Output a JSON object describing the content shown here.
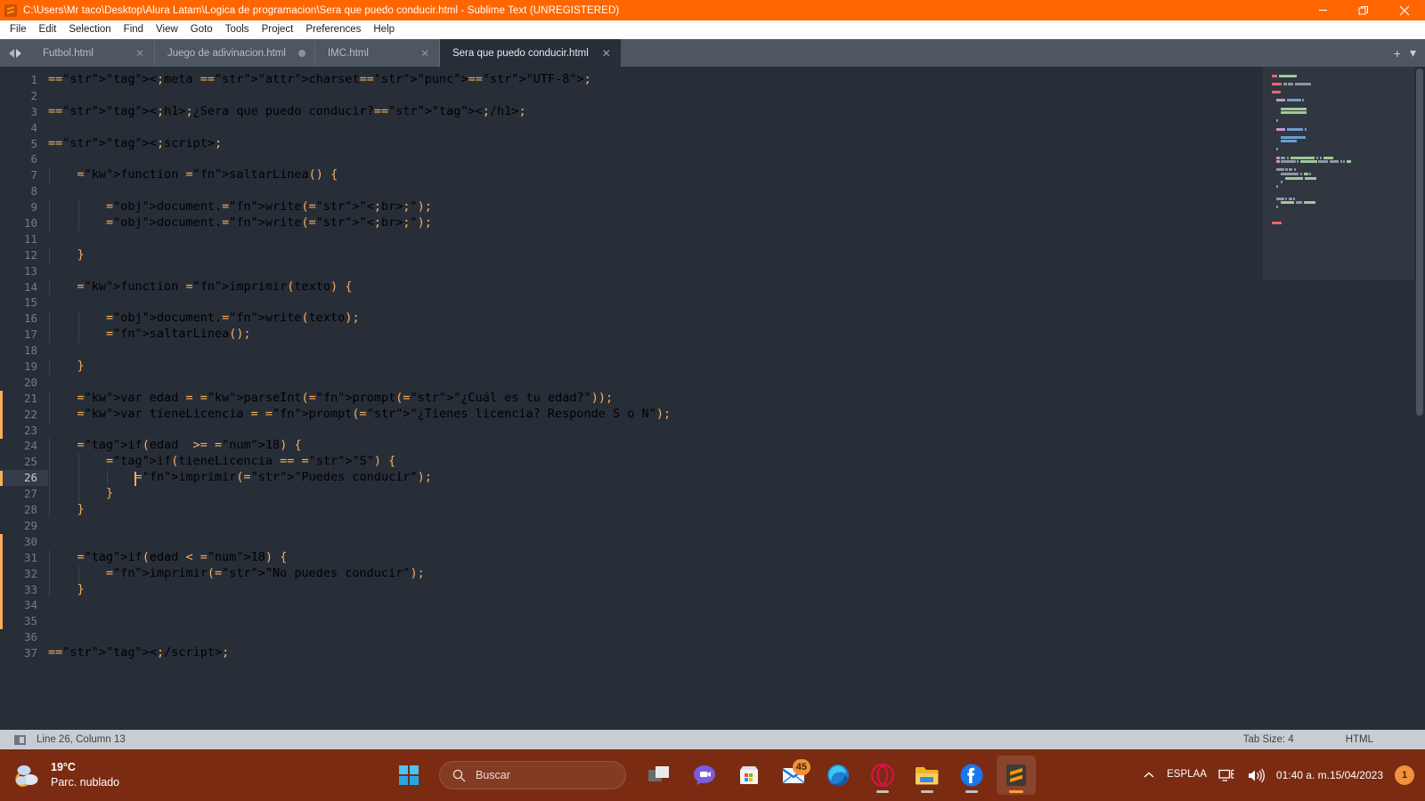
{
  "window": {
    "title": "C:\\Users\\Mr taco\\Desktop\\Alura Latam\\Logica de programacion\\Sera que puedo conducir.html - Sublime Text (UNREGISTERED)",
    "app_icon": "sublime-text-icon",
    "controls": {
      "minimize": "minimize-icon",
      "restore": "restore-icon",
      "close": "close-icon"
    },
    "accent_color": "#ff6600"
  },
  "menubar": {
    "items": [
      {
        "label": "File"
      },
      {
        "label": "Edit"
      },
      {
        "label": "Selection"
      },
      {
        "label": "Find"
      },
      {
        "label": "View"
      },
      {
        "label": "Goto"
      },
      {
        "label": "Tools"
      },
      {
        "label": "Project"
      },
      {
        "label": "Preferences"
      },
      {
        "label": "Help"
      }
    ]
  },
  "tabs": {
    "items": [
      {
        "label": "Futbol.html",
        "active": false,
        "dirty": false
      },
      {
        "label": "Juego de adivinacion.html",
        "active": false,
        "dirty": true
      },
      {
        "label": "IMC.html",
        "active": false,
        "dirty": false
      },
      {
        "label": "Sera que puedo conducir.html",
        "active": true,
        "dirty": false
      }
    ],
    "new_tab_label": "+",
    "overflow_label": "▾"
  },
  "editor": {
    "first_line": 1,
    "total_lines": 37,
    "active_line": 26,
    "caret_column": 13,
    "lines": [
      {
        "n": 1,
        "text": "<meta charset=\"UTF-8\">"
      },
      {
        "n": 2,
        "text": ""
      },
      {
        "n": 3,
        "text": "<h1>¿Sera que puedo conducir?</h1>"
      },
      {
        "n": 4,
        "text": ""
      },
      {
        "n": 5,
        "text": "<script>"
      },
      {
        "n": 6,
        "text": ""
      },
      {
        "n": 7,
        "text": "    function saltarLinea() {"
      },
      {
        "n": 8,
        "text": ""
      },
      {
        "n": 9,
        "text": "        document.write(\"<br>\");"
      },
      {
        "n": 10,
        "text": "        document.write(\"<br>\");"
      },
      {
        "n": 11,
        "text": ""
      },
      {
        "n": 12,
        "text": "    }"
      },
      {
        "n": 13,
        "text": ""
      },
      {
        "n": 14,
        "text": "    function imprimir(texto) {"
      },
      {
        "n": 15,
        "text": ""
      },
      {
        "n": 16,
        "text": "        document.write(texto);"
      },
      {
        "n": 17,
        "text": "        saltarLinea();"
      },
      {
        "n": 18,
        "text": ""
      },
      {
        "n": 19,
        "text": "    }"
      },
      {
        "n": 20,
        "text": ""
      },
      {
        "n": 21,
        "text": "    var edad = parseInt(prompt(\"¿Cuál es tu edad?\"));"
      },
      {
        "n": 22,
        "text": "    var tieneLicencia = prompt(\"¿Tienes licencia? Responde S o N\");"
      },
      {
        "n": 23,
        "text": ""
      },
      {
        "n": 24,
        "text": "    if(edad  >= 18) {"
      },
      {
        "n": 25,
        "text": "        if(tieneLicencia == \"S\") {"
      },
      {
        "n": 26,
        "text": "            imprimir(\"Puedes conducir\");"
      },
      {
        "n": 27,
        "text": "        }"
      },
      {
        "n": 28,
        "text": "    }"
      },
      {
        "n": 29,
        "text": ""
      },
      {
        "n": 30,
        "text": ""
      },
      {
        "n": 31,
        "text": "    if(edad < 18) {"
      },
      {
        "n": 32,
        "text": "        imprimir(\"No puedes conducir\");"
      },
      {
        "n": 33,
        "text": "    }"
      },
      {
        "n": 34,
        "text": ""
      },
      {
        "n": 35,
        "text": ""
      },
      {
        "n": 36,
        "text": ""
      },
      {
        "n": 37,
        "text": "</script>"
      }
    ],
    "theme": {
      "background": "#272e38",
      "line_number": "#6f7d8c",
      "active_line_gutter": "#343c48",
      "tag": "#ec5f67",
      "string": "#99c794",
      "keyword": "#c594c5",
      "function": "#6699cc",
      "number": "#f9ae58",
      "operator": "#f9ae58",
      "text": "#d8dee9",
      "caret": "#f9ae58",
      "change_marker": "#f9ae58"
    }
  },
  "statusbar": {
    "cursor_position": "Line 26, Column 13",
    "tab_size": "Tab Size: 4",
    "syntax": "HTML",
    "toggle_icon": "sidebar-toggle-icon"
  },
  "taskbar": {
    "weather": {
      "temperature": "19°C",
      "condition": "Parc. nublado",
      "icon": "partly-cloudy-night-icon"
    },
    "start": {
      "icon": "windows-start-icon"
    },
    "search": {
      "placeholder": "Buscar",
      "icon": "search-icon"
    },
    "apps": [
      {
        "name": "task-view-icon",
        "label": "Task View",
        "running": false,
        "badge": null
      },
      {
        "name": "chat-icon",
        "label": "Chat",
        "running": false,
        "badge": null
      },
      {
        "name": "microsoft-store-icon",
        "label": "Microsoft Store",
        "running": false,
        "badge": null
      },
      {
        "name": "mail-icon",
        "label": "Mail",
        "running": false,
        "badge": "45"
      },
      {
        "name": "microsoft-edge-icon",
        "label": "Microsoft Edge",
        "running": false,
        "badge": null
      },
      {
        "name": "opera-icon",
        "label": "Opera",
        "running": true,
        "badge": null
      },
      {
        "name": "file-explorer-icon",
        "label": "File Explorer",
        "running": true,
        "badge": null
      },
      {
        "name": "facebook-icon",
        "label": "Facebook",
        "running": true,
        "badge": null
      },
      {
        "name": "sublime-text-icon",
        "label": "Sublime Text",
        "running": true,
        "active": true,
        "badge": null
      }
    ],
    "tray": {
      "overflow_icon": "chevron-up-icon",
      "language_primary": "ESP",
      "language_secondary": "LAA",
      "network_icon": "network-icon",
      "volume_icon": "volume-icon",
      "time": "01:40 a. m.",
      "date": "15/04/2023",
      "notification_count": "1"
    }
  }
}
